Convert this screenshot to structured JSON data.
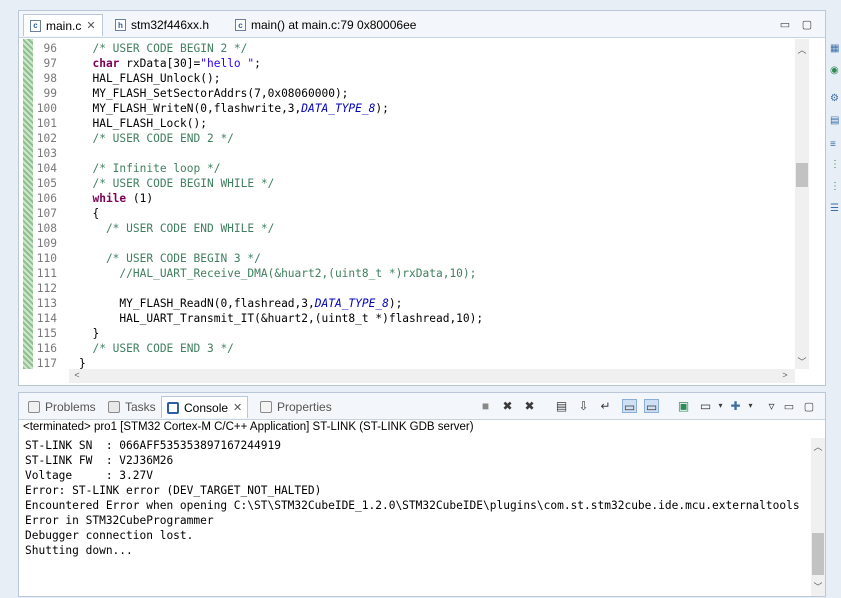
{
  "editor": {
    "tabs": [
      {
        "label": "main.c",
        "icon": "c-file-icon",
        "glyph": "c",
        "active": true,
        "closable": true
      },
      {
        "label": "stm32f446xx.h",
        "icon": "h-file-icon",
        "glyph": "h",
        "active": false,
        "closable": false
      },
      {
        "label": "main() at main.c:79 0x80006ee",
        "icon": "c-file-icon",
        "glyph": "c",
        "active": false,
        "closable": false
      }
    ],
    "lines": [
      {
        "n": "96",
        "parts": [
          [
            "cm",
            "  /* USER CODE BEGIN 2 */"
          ]
        ]
      },
      {
        "n": "97",
        "parts": [
          [
            "kw",
            "  char"
          ],
          [
            "tx",
            " rxData[30]="
          ],
          [
            "st",
            "\"hello \""
          ],
          [
            "tx",
            ";"
          ]
        ]
      },
      {
        "n": "98",
        "parts": [
          [
            "tx",
            "  HAL_FLASH_Unlock();"
          ]
        ]
      },
      {
        "n": "99",
        "parts": [
          [
            "tx",
            "  MY_FLASH_SetSectorAddrs(7,0x08060000);"
          ]
        ]
      },
      {
        "n": "100",
        "parts": [
          [
            "tx",
            "  MY_FLASH_WriteN(0,flashwrite,3,"
          ],
          [
            "it",
            "DATA_TYPE_8"
          ],
          [
            "tx",
            ");"
          ]
        ]
      },
      {
        "n": "101",
        "parts": [
          [
            "tx",
            "  HAL_FLASH_Lock();"
          ]
        ]
      },
      {
        "n": "102",
        "parts": [
          [
            "cm",
            "  /* USER CODE END 2 */"
          ]
        ]
      },
      {
        "n": "103",
        "parts": [
          [
            "tx",
            ""
          ]
        ]
      },
      {
        "n": "104",
        "parts": [
          [
            "cm",
            "  /* Infinite loop */"
          ]
        ]
      },
      {
        "n": "105",
        "parts": [
          [
            "cm",
            "  /* USER CODE BEGIN WHILE */"
          ]
        ]
      },
      {
        "n": "106",
        "parts": [
          [
            "kw",
            "  while"
          ],
          [
            "tx",
            " (1)"
          ]
        ]
      },
      {
        "n": "107",
        "parts": [
          [
            "tx",
            "  {"
          ]
        ]
      },
      {
        "n": "108",
        "parts": [
          [
            "cm",
            "    /* USER CODE END WHILE */"
          ]
        ]
      },
      {
        "n": "109",
        "parts": [
          [
            "tx",
            ""
          ]
        ]
      },
      {
        "n": "110",
        "parts": [
          [
            "cm",
            "    /* USER CODE BEGIN 3 */"
          ]
        ]
      },
      {
        "n": "111",
        "parts": [
          [
            "cm",
            "      //HAL_UART_Receive_DMA(&huart2,(uint8_t *)rxData,10);"
          ]
        ]
      },
      {
        "n": "112",
        "parts": [
          [
            "tx",
            ""
          ]
        ]
      },
      {
        "n": "113",
        "parts": [
          [
            "tx",
            "      MY_FLASH_ReadN(0,flashread,3,"
          ],
          [
            "it",
            "DATA_TYPE_8"
          ],
          [
            "tx",
            ");"
          ]
        ]
      },
      {
        "n": "114",
        "parts": [
          [
            "tx",
            "      HAL_UART_Transmit_IT(&huart2,(uint8_t *)flashread,10);"
          ]
        ]
      },
      {
        "n": "115",
        "parts": [
          [
            "tx",
            "  }"
          ]
        ]
      },
      {
        "n": "116",
        "parts": [
          [
            "cm",
            "  /* USER CODE END 3 */"
          ]
        ]
      },
      {
        "n": "117",
        "parts": [
          [
            "tx",
            "}"
          ]
        ]
      }
    ]
  },
  "console": {
    "tabs": [
      {
        "label": "Problems",
        "icon": "problems-icon",
        "active": false
      },
      {
        "label": "Tasks",
        "icon": "tasks-icon",
        "active": false
      },
      {
        "label": "Console",
        "icon": "console-icon",
        "active": true
      },
      {
        "label": "Properties",
        "icon": "properties-icon",
        "active": false
      }
    ],
    "title": "<terminated> pro1 [STM32 Cortex-M C/C++ Application] ST-LINK (ST-LINK GDB server)",
    "output": [
      "ST-LINK SN  : 066AFF535353897167244919",
      "ST-LINK FW  : V2J36M26",
      "Voltage     : 3.27V",
      "Error: ST-LINK error (DEV_TARGET_NOT_HALTED)",
      "Encountered Error when opening C:\\ST\\STM32CubeIDE_1.2.0\\STM32CubeIDE\\plugins\\com.st.stm32cube.ide.mcu.externaltools",
      "Error in STM32CubeProgrammer",
      "Debugger connection lost.",
      "Shutting down..."
    ]
  },
  "colors": {
    "comment": "#3f7f5f",
    "keyword": "#7f0055",
    "string": "#2a00ff",
    "macro": "#0000c0",
    "frame_border": "#b9c7d9"
  }
}
